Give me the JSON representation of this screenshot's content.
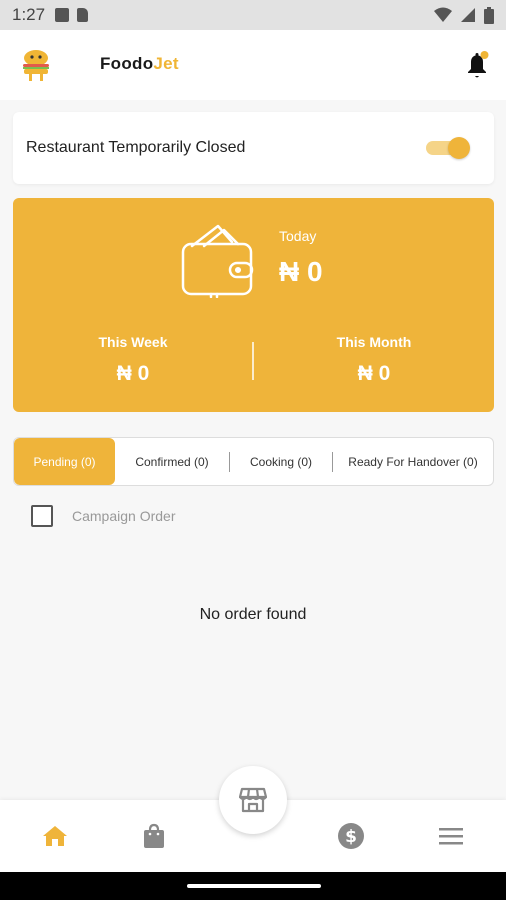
{
  "status_bar": {
    "time": "1:27"
  },
  "app_bar": {
    "brand_part1": "Foodo",
    "brand_part2": "Jet",
    "logo_icon": "burger-mascot-icon",
    "bell_icon": "bell-icon"
  },
  "restaurant_status": {
    "label": "Restaurant Temporarily Closed",
    "toggle_on": true
  },
  "earnings": {
    "today_label": "Today",
    "today_value": "₦ 0",
    "week_label": "This Week",
    "week_value": "₦ 0",
    "month_label": "This Month",
    "month_value": "₦ 0"
  },
  "order_tabs": [
    {
      "label": "Pending (0)",
      "active": true
    },
    {
      "label": "Confirmed (0)",
      "active": false
    },
    {
      "label": "Cooking (0)",
      "active": false
    },
    {
      "label": "Ready For Handover (0)",
      "active": false
    }
  ],
  "campaign_filter": {
    "label": "Campaign Order",
    "checked": false
  },
  "empty_message": "No order found",
  "bottom_nav": [
    "home-icon",
    "shopping-bag-icon",
    "store-icon",
    "dollar-icon",
    "menu-icon"
  ],
  "colors": {
    "accent": "#efb43a",
    "accent_light": "#f5d488"
  }
}
